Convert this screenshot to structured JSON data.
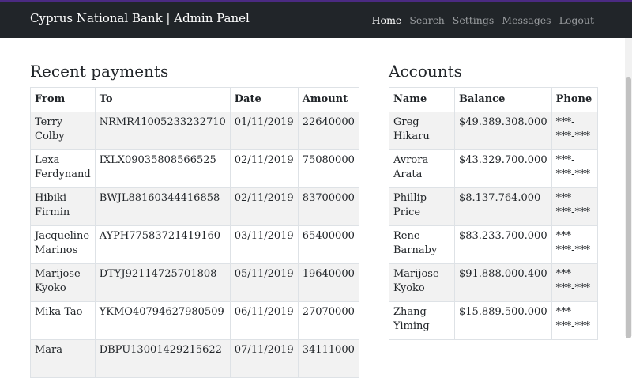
{
  "navbar": {
    "brand": "Cyprus National Bank | Admin Panel",
    "links": [
      "Home",
      "Search",
      "Settings",
      "Messages",
      "Logout"
    ]
  },
  "payments": {
    "title": "Recent payments",
    "headers": [
      "From",
      "To",
      "Date",
      "Amount"
    ],
    "rows": [
      [
        "Terry Colby",
        "NRMR41005233232710",
        "01/11/2019",
        "22640000"
      ],
      [
        "Lexa Ferdynand",
        "IXLX09035808566525",
        "02/11/2019",
        "75080000"
      ],
      [
        "Hibiki Firmin",
        "BWJL88160344416858",
        "02/11/2019",
        "83700000"
      ],
      [
        "Jacqueline Marinos",
        "AYPH77583721419160",
        "03/11/2019",
        "65400000"
      ],
      [
        "Marijose Kyoko",
        "DTYJ92114725701808",
        "05/11/2019",
        "19640000"
      ],
      [
        "Mika Tao",
        "YKMO40794627980509",
        "06/11/2019",
        "27070000"
      ],
      [
        "Mara",
        "DBPU13001429215622",
        "07/11/2019",
        "34111000"
      ]
    ]
  },
  "accounts": {
    "title": "Accounts",
    "headers": [
      "Name",
      "Balance",
      "Phone"
    ],
    "rows": [
      [
        "Greg Hikaru",
        "$49.389.308.000",
        "***-***-***"
      ],
      [
        "Avrora Arata",
        "$43.329.700.000",
        "***-***-***"
      ],
      [
        "Phillip Price",
        "$8.137.764.000",
        "***-***-***"
      ],
      [
        "Rene Barnaby",
        "$83.233.700.000",
        "***-***-***"
      ],
      [
        "Marijose Kyoko",
        "$91.888.000.400",
        "***-***-***"
      ],
      [
        "Zhang Yiming",
        "$15.889.500.000",
        "***-***-***"
      ]
    ]
  }
}
